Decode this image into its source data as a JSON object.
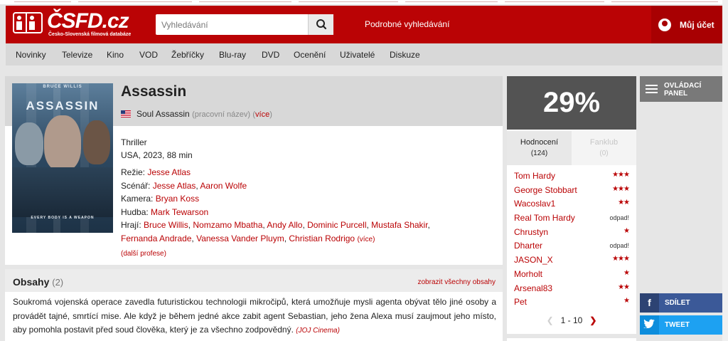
{
  "header": {
    "brand": "ČSFD.cz",
    "tagline": "Česko-Slovenská filmová databáze",
    "search_placeholder": "Vyhledávání",
    "advanced_search": "Podrobné vyhledávání",
    "account": "Můj účet"
  },
  "menu": [
    "Novinky",
    "Televize",
    "Kino",
    "VOD",
    "Žebříčky",
    "Blu-ray",
    "DVD",
    "Ocenění",
    "Uživatelé",
    "Diskuze"
  ],
  "film": {
    "title": "Assassin",
    "alt_title": "Soul Assassin",
    "alt_note": "(pracovní název)",
    "alt_more": "více",
    "genre": "Thriller",
    "origin": "USA, 2023, 88 min",
    "poster": {
      "top_text": "BRUCE WILLIS",
      "title": "ASSASSIN",
      "tagline": "EVERY BODY IS A WEAPON"
    },
    "crew": {
      "direction_label": "Režie:",
      "direction": [
        "Jesse Atlas"
      ],
      "screenplay_label": "Scénář:",
      "screenplay": [
        "Jesse Atlas",
        "Aaron Wolfe"
      ],
      "camera_label": "Kamera:",
      "camera": [
        "Bryan Koss"
      ],
      "music_label": "Hudba:",
      "music": [
        "Mark Tewarson"
      ],
      "cast_label": "Hrají:",
      "cast": [
        "Bruce Willis",
        "Nomzamo Mbatha",
        "Andy Allo",
        "Dominic Purcell",
        "Mustafa Shakir",
        "Fernanda Andrade",
        "Vanessa Vander Pluym",
        "Christian Rodrigo"
      ],
      "cast_more": "(více)",
      "other_professions": "(další profese)"
    }
  },
  "plot": {
    "heading": "Obsahy",
    "count": "(2)",
    "show_all": "zobrazit všechny obsahy",
    "text": "Soukromá vojenská operace zavedla futuristickou technologii mikročipů, která umožňuje mysli agenta obývat tělo jiné osoby a provádět tajné, smrtící mise. Ale když je během jedné akce zabit agent Sebastian, jeho žena Alexa musí zaujmout jeho místo, aby pomohla postavit před soud člověka, který je za všechno zodpovědný.",
    "source": "(JOJ Cinema)"
  },
  "rating": {
    "percent": "29%",
    "tab_ratings": "Hodnocení",
    "tab_ratings_count": "(124)",
    "tab_fanclub": "Fanklub",
    "tab_fanclub_count": "(0)",
    "users": [
      {
        "name": "Tom Hardy",
        "score": "★★★"
      },
      {
        "name": "George Stobbart",
        "score": "★★★"
      },
      {
        "name": "Wacoslav1",
        "score": "★★"
      },
      {
        "name": "Real Tom Hardy",
        "score": "odpad!"
      },
      {
        "name": "Chrustyn",
        "score": "★"
      },
      {
        "name": "Dharter",
        "score": "odpad!"
      },
      {
        "name": "JASON_X",
        "score": "★★★"
      },
      {
        "name": "Morholt",
        "score": "★"
      },
      {
        "name": "Arsenal83",
        "score": "★★"
      },
      {
        "name": "Pet",
        "score": "★"
      }
    ],
    "pager": "1 - 10"
  },
  "side": {
    "panel": "OVLÁDACÍ PANEL",
    "share_fb": "SDÍLET",
    "share_tw": "TWEET"
  },
  "colors": {
    "brand_red": "#ba0305",
    "rating_box": "#535353",
    "facebook": "#3b5998",
    "twitter": "#1da1f2"
  }
}
